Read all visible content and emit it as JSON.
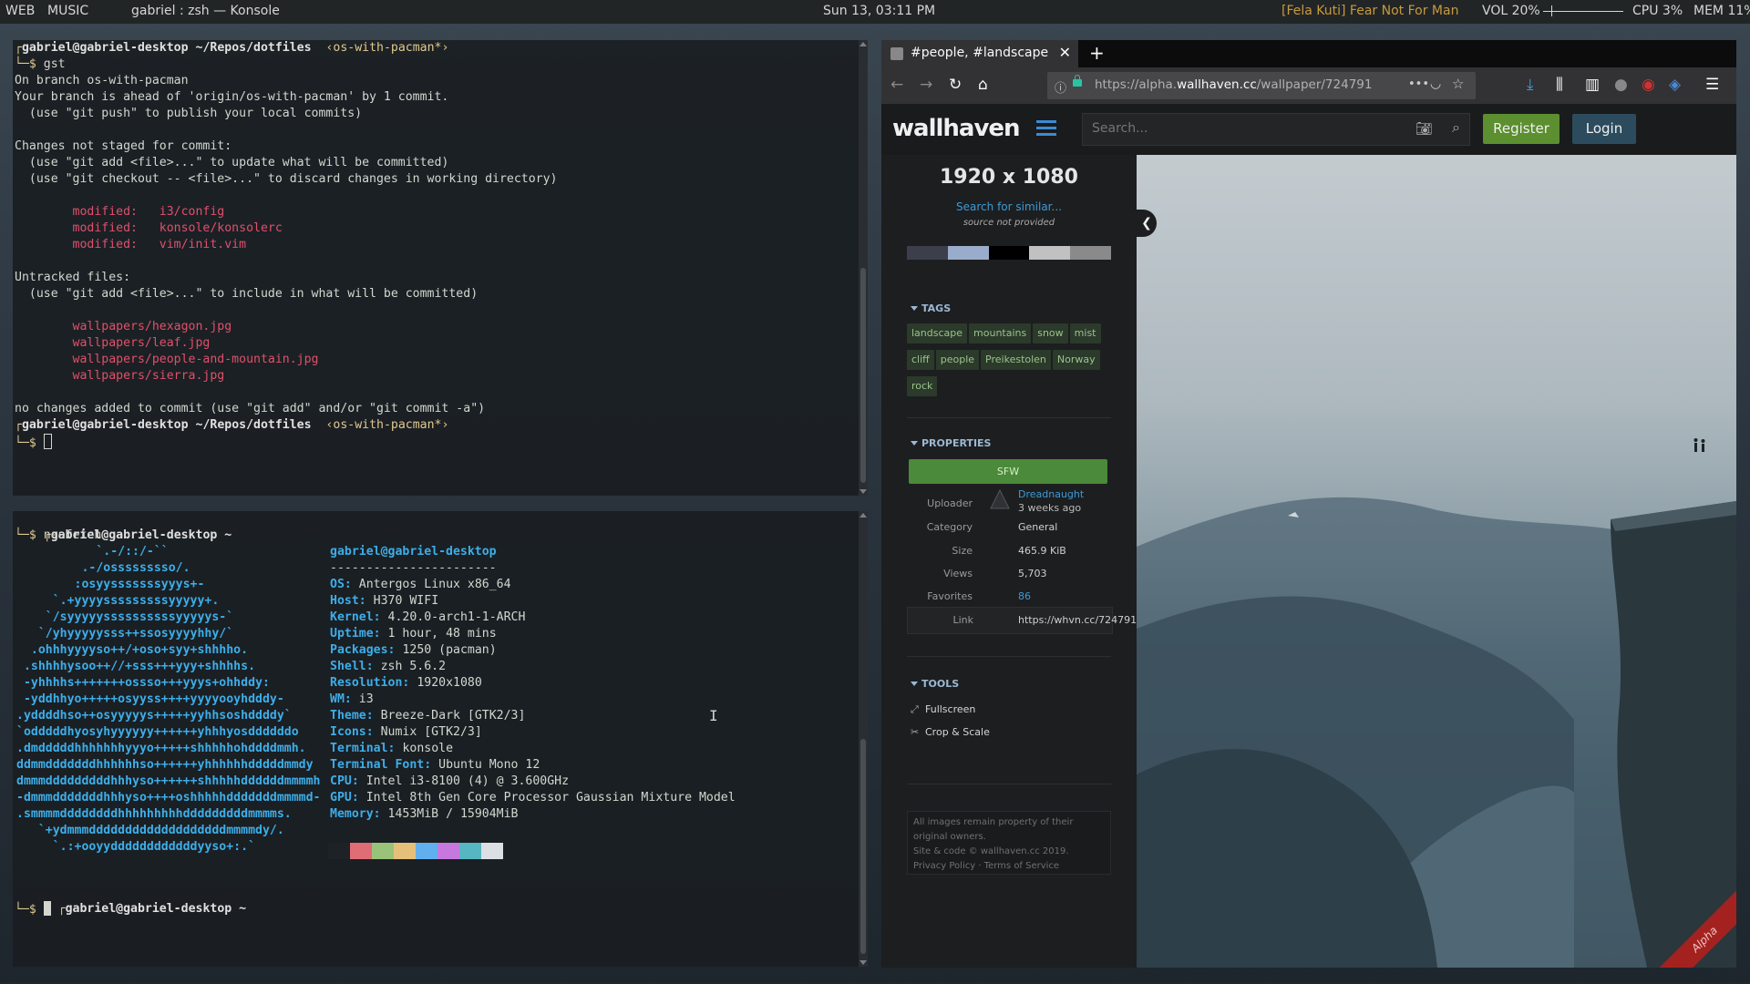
{
  "topbar": {
    "workspaces": [
      "WEB",
      "MUSIC"
    ],
    "window_title": "gabriel : zsh — Konsole",
    "clock": "Sun 13, 03:11 PM",
    "now_playing": "[Fela Kuti] Fear Not For Man",
    "volume": "VOL 20%",
    "volume_level": 0.2,
    "cpu": "CPU 3%",
    "mem": "MEM 11%"
  },
  "terminal_top": {
    "lines": [
      {
        "user": "gabriel@gabriel-desktop",
        "path": " ~/Repos/dotfiles",
        "branch": "  ‹os-with-pacman*›"
      },
      {
        "prompt_cmd": "gst"
      },
      {
        "text": "On branch os-with-pacman"
      },
      {
        "text": "Your branch is ahead of 'origin/os-with-pacman' by 1 commit."
      },
      {
        "text": "  (use \"git push\" to publish your local commits)"
      },
      {
        "text": ""
      },
      {
        "text": "Changes not staged for commit:"
      },
      {
        "text": "  (use \"git add <file>...\" to update what will be committed)"
      },
      {
        "text": "  (use \"git checkout -- <file>...\" to discard changes in working directory)"
      },
      {
        "text": ""
      },
      {
        "red": "        modified:   i3/config"
      },
      {
        "red": "        modified:   konsole/konsolerc"
      },
      {
        "red": "        modified:   vim/init.vim"
      },
      {
        "text": ""
      },
      {
        "text": "Untracked files:"
      },
      {
        "text": "  (use \"git add <file>...\" to include in what will be committed)"
      },
      {
        "text": ""
      },
      {
        "red": "        wallpapers/hexagon.jpg"
      },
      {
        "red": "        wallpapers/leaf.jpg"
      },
      {
        "red": "        wallpapers/people-and-mountain.jpg"
      },
      {
        "red": "        wallpapers/sierra.jpg"
      },
      {
        "text": ""
      },
      {
        "text": "no changes added to commit (use \"git add\" and/or \"git commit -a\")"
      },
      {
        "user": "gabriel@gabriel-desktop",
        "path": " ~/Repos/dotfiles",
        "branch": "  ‹os-with-pacman*›"
      },
      {
        "prompt_cursor": true
      }
    ]
  },
  "terminal_bottom": {
    "prompt1": {
      "user": "gabriel@gabriel-desktop",
      "path": " ~"
    },
    "cmd": "neofetch",
    "art": [
      "           `.-/::/-``",
      "         .-/osssssssso/.",
      "        :osyysssssssyyys+-",
      "     `.+yyyysssssssssyyyyy+.",
      "    `/syyyyyssssssssssyyyyys-`",
      "   `/yhyyyyysss++ssosyyyyhhy/`",
      "  .ohhhyyyyso++/+oso+syy+shhhho.",
      " .shhhhysoo++//+sss+++yyy+shhhhs.",
      " -yhhhhs+++++++ossso+++yyys+ohhddy:",
      " -yddhhyo+++++osyyss++++yyyyooyhdddy-",
      ".yddddhso++osyyyyys+++++yyhhsoshddddy`",
      "`odddddhyosyhyyyyyy++++++yhhhyosddddddo",
      ".dmdddddhhhhhhhyyyo+++++shhhhhohddddmmh.",
      "ddmmdddddddhhhhhhso++++++yhhhhhhdddddmmdy",
      "dmmmdddddddddhhhyso++++++shhhhhddddddmmmmh",
      "-dmmmdddddddhhhyso++++oshhhhhdddddddmmmmd-",
      ".smmmmddddddddhhhhhhhhhdddddddddmmmms.",
      "   `+ydmmmdddddddddddddddddddmmmmdy/.",
      "     `.:+ooyyddddddddddddyyso+:.`"
    ],
    "info_title": "gabriel@gabriel-desktop",
    "info_sep": "-----------------------",
    "info": [
      {
        "k": "OS",
        "v": "Antergos Linux x86_64"
      },
      {
        "k": "Host",
        "v": "H370 WIFI"
      },
      {
        "k": "Kernel",
        "v": "4.20.0-arch1-1-ARCH"
      },
      {
        "k": "Uptime",
        "v": "1 hour, 48 mins"
      },
      {
        "k": "Packages",
        "v": "1250 (pacman)"
      },
      {
        "k": "Shell",
        "v": "zsh 5.6.2"
      },
      {
        "k": "Resolution",
        "v": "1920x1080"
      },
      {
        "k": "WM",
        "v": "i3"
      },
      {
        "k": "Theme",
        "v": "Breeze-Dark [GTK2/3]"
      },
      {
        "k": "Icons",
        "v": "Numix [GTK2/3]"
      },
      {
        "k": "Terminal",
        "v": "konsole"
      },
      {
        "k": "Terminal Font",
        "v": "Ubuntu Mono 12"
      },
      {
        "k": "CPU",
        "v": "Intel i3-8100 (4) @ 3.600GHz"
      },
      {
        "k": "GPU",
        "v": "Intel 8th Gen Core Processor Gaussian Mixture Model"
      },
      {
        "k": "Memory",
        "v": "1453MiB / 15904MiB"
      }
    ],
    "swatch_colors": [
      "#1e2226",
      "#e06c75",
      "#98c379",
      "#e5c07b",
      "#61afef",
      "#c678dd",
      "#56b6c2",
      "#dcdfe4"
    ],
    "prompt2": {
      "user": "gabriel@gabriel-desktop",
      "path": " ~"
    }
  },
  "browser": {
    "tab_title": "#people, #landscape, #",
    "url_host_prefix": "https://alpha.",
    "url_host": "wallhaven.cc",
    "url_path": "/wallpaper/724791",
    "more_label": "•••"
  },
  "wallhaven": {
    "logo": "wallhaven",
    "search_placeholder": "Search...",
    "register": "Register",
    "login": "Login",
    "resolution": "1920 x 1080",
    "search_similar": "Search for similar...",
    "source": "source not provided",
    "palette": [
      "#3c3f4b",
      "#9aaccb",
      "#000000",
      "#c1c1c1",
      "#8a8a8a"
    ],
    "tags_title": "TAGS",
    "tags": [
      "landscape",
      "mountains",
      "snow",
      "mist",
      "cliff",
      "people",
      "Preikestolen",
      "Norway",
      "rock"
    ],
    "properties_title": "PROPERTIES",
    "sfw": "SFW",
    "props": {
      "uploader_label": "Uploader",
      "uploader": "Dreadnaught",
      "uploaded": "3 weeks ago",
      "category_label": "Category",
      "category": "General",
      "size_label": "Size",
      "size": "465.9 KiB",
      "views_label": "Views",
      "views": "5,703",
      "favorites_label": "Favorites",
      "favorites": "86",
      "link_label": "Link",
      "link": "https://whvn.cc/724791"
    },
    "tools_title": "TOOLS",
    "tools": [
      "Fullscreen",
      "Crop & Scale"
    ],
    "footer": [
      "All images remain property of their",
      "original owners.",
      "Site & code © wallhaven.cc 2019.",
      "Privacy Policy · Terms of Service"
    ],
    "ribbon": "Alpha"
  }
}
